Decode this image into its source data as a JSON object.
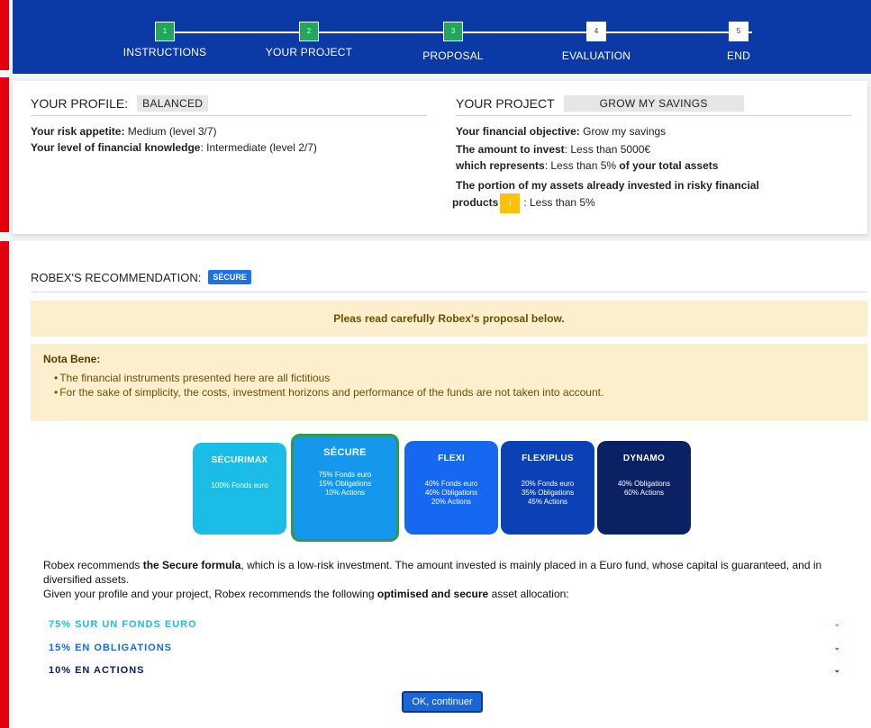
{
  "steps": [
    {
      "number": "1",
      "label": "INSTRUCTIONS",
      "state": "done"
    },
    {
      "number": "2",
      "label": "YOUR PROJECT",
      "state": "done"
    },
    {
      "number": "3",
      "label": "PROPOSAL",
      "state": "done"
    },
    {
      "number": "4",
      "label": "EVALUATION",
      "state": "todo"
    },
    {
      "number": "5",
      "label": "END",
      "state": "todo"
    }
  ],
  "profile": {
    "heading": "YOUR PROFILE:",
    "tag": "BALANCED",
    "risk_label": "Your risk appetite:",
    "risk_value": " Medium (level 3/7)",
    "knowledge_label": "Your level of financial knowledge",
    "knowledge_value": ": Intermediate (level 2/7)"
  },
  "project": {
    "heading": "YOUR PROJECT",
    "tag": "GROW MY SAVINGS",
    "objective_label": "Your financial objective:",
    "objective_value": " Grow my savings",
    "amount_label": "The amount to invest",
    "amount_value": ": Less than 5000€",
    "represents_label": "which represents",
    "represents_value": ": Less than 5% ",
    "represents_suffix": "of your total assets",
    "portion_label": "The portion of my assets already invested in risky financial",
    "portion_label_2": "products",
    "info_icon_glyph": "i",
    "portion_value": ": Less than 5%"
  },
  "recommendation": {
    "heading": "ROBEX'S RECOMMENDATION:",
    "badge": "SÉCURE",
    "notice": "Pleas read carefully Robex's proposal below.",
    "nb_title": "Nota Bene:",
    "nb_items": [
      "The financial instruments presented here are all fictitious",
      "For the sake of simplicity, the costs, investment horizons and performance of the funds are not taken into account."
    ]
  },
  "funds": [
    {
      "name": "SÉCURIMAX",
      "lines": [
        "100% Fonds euro"
      ],
      "color": "#1bbde6",
      "selected": false
    },
    {
      "name": "SÉCURE",
      "lines": [
        "75% Fonds euro",
        "15% Obligations",
        "10% Actions"
      ],
      "color": "#1597ec",
      "selected": true
    },
    {
      "name": "FLEXI",
      "lines": [
        "40% Fonds euro",
        "40% Obligations",
        "20% Actions"
      ],
      "color": "#1668f0",
      "selected": false
    },
    {
      "name": "FLEXIPLUS",
      "lines": [
        "20% Fonds euro",
        "35% Obligations",
        "45% Actions"
      ],
      "color": "#0b41b4",
      "selected": false
    },
    {
      "name": "DYNAMO",
      "lines": [
        "40% Obligations",
        "60% Actions"
      ],
      "color": "#0a2164",
      "selected": false
    }
  ],
  "reco_text": {
    "p1_a": "Robex recommends ",
    "p1_b": "the Secure formula",
    "p1_c": ", which is a low-risk investment. The amount invested is mainly placed in a Euro fund, whose capital is guaranteed, and in diversified assets.",
    "p2_a": "Given your profile and your project, Robex recommends the following ",
    "p2_b": "optimised and secure",
    "p2_c": " asset allocation:"
  },
  "allocation": [
    {
      "label": "75% SUR UN FONDS EURO",
      "color": "#1bbde6"
    },
    {
      "label": "15% EN OBLIGATIONS",
      "color": "#1668f0"
    },
    {
      "label": "10% EN ACTIONS",
      "color": "#0a2164"
    }
  ],
  "chevron_glyph": "⌄",
  "ok_button": "OK, continuer",
  "colors": {
    "header_blue": "#0b3aa6",
    "step_done": "#22a55c",
    "accent_red": "#e3000f",
    "notice_bg": "#fcefcd"
  }
}
